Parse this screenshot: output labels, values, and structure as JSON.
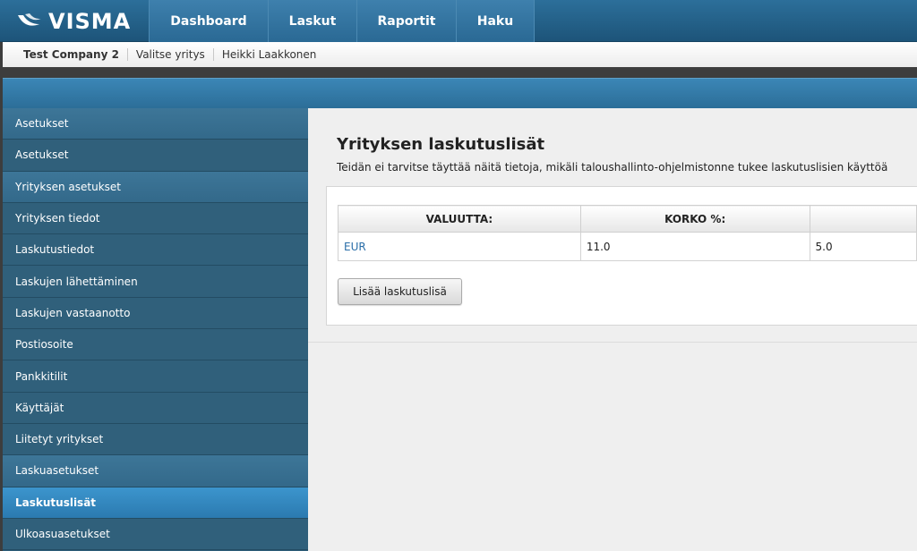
{
  "brand": {
    "logo_text": "VISMA"
  },
  "nav": {
    "items": [
      {
        "label": "Dashboard"
      },
      {
        "label": "Laskut"
      },
      {
        "label": "Raportit"
      },
      {
        "label": "Haku"
      }
    ]
  },
  "companybar": {
    "company": "Test Company 2",
    "select_company": "Valitse yritys",
    "user": "Heikki Laakkonen"
  },
  "sidebar": {
    "items": [
      {
        "label": "Asetukset",
        "type": "head"
      },
      {
        "label": "Asetukset",
        "type": "item"
      },
      {
        "label": "Yrityksen asetukset",
        "type": "head"
      },
      {
        "label": "Yrityksen tiedot",
        "type": "item"
      },
      {
        "label": "Laskutustiedot",
        "type": "item"
      },
      {
        "label": "Laskujen lähettäminen",
        "type": "item"
      },
      {
        "label": "Laskujen vastaanotto",
        "type": "item"
      },
      {
        "label": "Postiosoite",
        "type": "item"
      },
      {
        "label": "Pankkitilit",
        "type": "item"
      },
      {
        "label": "Käyttäjät",
        "type": "item"
      },
      {
        "label": "Liitetyt yritykset",
        "type": "item"
      },
      {
        "label": "Laskuasetukset",
        "type": "head"
      },
      {
        "label": "Laskutuslisät",
        "type": "active"
      },
      {
        "label": "Ulkoasuasetukset",
        "type": "item"
      }
    ]
  },
  "main": {
    "title": "Yrityksen laskutuslisät",
    "description": "Teidän ei tarvitse täyttää näitä tietoja, mikäli taloushallinto-ohjelmistonne tukee laskutuslisien käyttöä",
    "table": {
      "headers": [
        "VALUUTTA:",
        "KORKO %:",
        ""
      ],
      "rows": [
        [
          "EUR",
          "11.0",
          "5.0"
        ]
      ]
    },
    "add_button": "Lisää laskutuslisä"
  },
  "colors": {
    "nav_bg": "#2c6f9a",
    "sidebar_bg": "#30607b",
    "sidebar_active": "#3c95cd",
    "link": "#2a6ea8"
  }
}
